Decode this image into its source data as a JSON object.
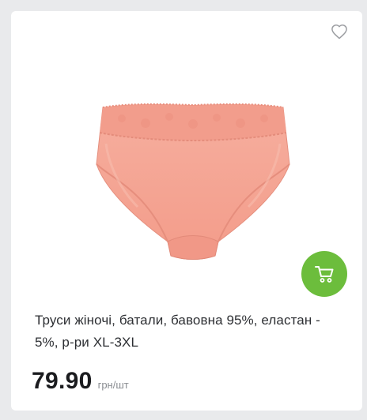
{
  "product": {
    "title": "Труси жіночі, батали, бавовна 95%, еластан - 5%, р-ри XL-3XL",
    "price": "79.90",
    "unit": "грн/шт",
    "image_alt": "peach cotton briefs",
    "favorite_icon": "heart-outline-icon",
    "cart_icon": "shopping-cart-icon"
  },
  "colors": {
    "cart_button": "#6cbd3c",
    "product_fabric": "#f4a898",
    "page_background": "#e9eaec"
  }
}
